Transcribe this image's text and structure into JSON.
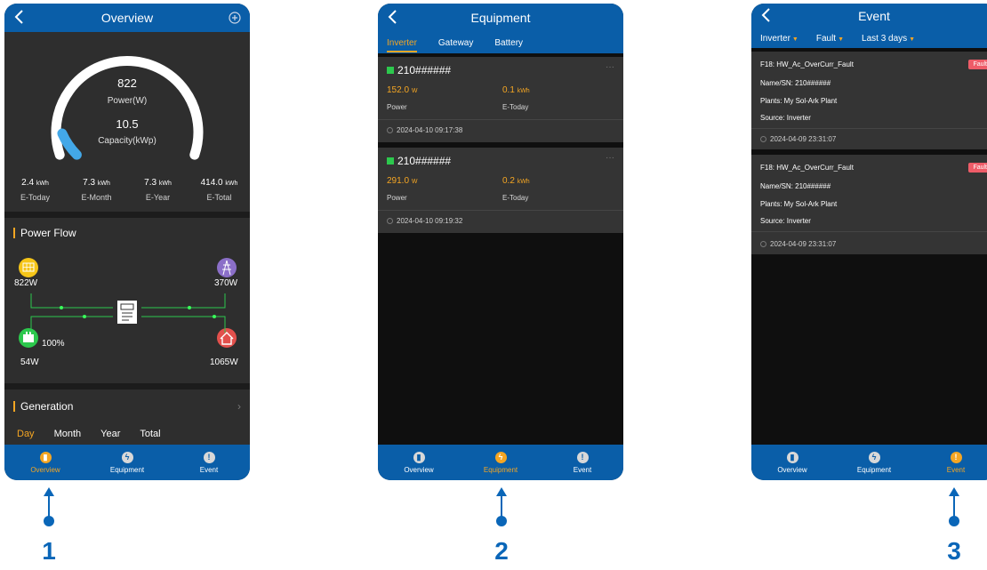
{
  "colors": {
    "header": "#0a5ea8",
    "accent": "#f5a623",
    "panel": "#2e2e2e",
    "green": "#2cc84d",
    "fault": "#ee5c68",
    "callout": "#0a66b8"
  },
  "nav": {
    "overview": "Overview",
    "equipment": "Equipment",
    "event": "Event"
  },
  "overview": {
    "title": "Overview",
    "power_value": "822",
    "power_label": "Power(W)",
    "capacity_value": "10.5",
    "capacity_label": "Capacity(kWp)",
    "power_fraction": 0.078,
    "stats": [
      {
        "value": "2.4",
        "unit": "kWh",
        "label": "E-Today"
      },
      {
        "value": "7.3",
        "unit": "kWh",
        "label": "E-Month"
      },
      {
        "value": "7.3",
        "unit": "kWh",
        "label": "E-Year"
      },
      {
        "value": "414.0",
        "unit": "kWh",
        "label": "E-Total"
      }
    ],
    "power_flow_title": "Power Flow",
    "flow": {
      "solar": "822W",
      "grid": "370W",
      "battery_pct": "100%",
      "battery": "54W",
      "load": "1065W"
    },
    "generation_title": "Generation",
    "generation_tabs": [
      "Day",
      "Month",
      "Year",
      "Total"
    ]
  },
  "equipment": {
    "title": "Equipment",
    "tabs": [
      "Inverter",
      "Gateway",
      "Battery"
    ],
    "devices": [
      {
        "sn": "210######",
        "power": "152.0",
        "power_unit": "W",
        "power_label": "Power",
        "etoday": "0.1",
        "etoday_unit": "kWh",
        "etoday_label": "E-Today",
        "time": "2024-04-10 09:17:38"
      },
      {
        "sn": "210######",
        "power": "291.0",
        "power_unit": "W",
        "power_label": "Power",
        "etoday": "0.2",
        "etoday_unit": "kWh",
        "etoday_label": "E-Today",
        "time": "2024-04-10 09:19:32"
      }
    ]
  },
  "event": {
    "title": "Event",
    "filters": [
      "Inverter",
      "Fault",
      "Last 3 days"
    ],
    "items": [
      {
        "code": "F18: HW_Ac_OverCurr_Fault",
        "badge": "Fault",
        "name": "Name/SN: 210######",
        "plant": "Plants: My Sol-Ark Plant",
        "source": "Source: Inverter",
        "time": "2024-04-09 23:31:07"
      },
      {
        "code": "F18: HW_Ac_OverCurr_Fault",
        "badge": "Fault",
        "name": "Name/SN: 210######",
        "plant": "Plants: My Sol-Ark Plant",
        "source": "Source: Inverter",
        "time": "2024-04-09 23:31:07"
      }
    ]
  },
  "callouts": [
    "1",
    "2",
    "3"
  ]
}
